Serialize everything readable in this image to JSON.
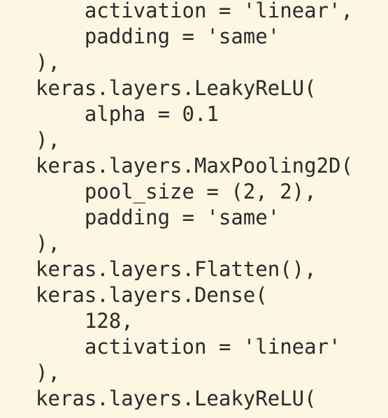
{
  "code": {
    "lines": [
      "    activation = 'linear',",
      "    padding = 'same'",
      "),",
      "keras.layers.LeakyReLU(",
      "    alpha = 0.1",
      "),",
      "keras.layers.MaxPooling2D(",
      "    pool_size = (2, 2),",
      "    padding = 'same'",
      "),",
      "keras.layers.Flatten(),",
      "keras.layers.Dense(",
      "    128,",
      "    activation = 'linear'",
      "),",
      "keras.layers.LeakyReLU("
    ]
  },
  "colors": {
    "background": "#fdf6e3",
    "text": "#2a2a2a"
  }
}
